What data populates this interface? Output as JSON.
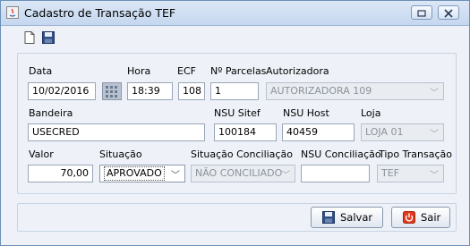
{
  "window": {
    "title": "Cadastro de Transação TEF"
  },
  "toolbar": {
    "new_icon": "new-document-icon",
    "save_icon": "floppy-disk-icon"
  },
  "labels": {
    "data": "Data",
    "hora": "Hora",
    "ecf": "ECF",
    "parcelas": "Nº Parcelas",
    "autorizadora": "Autorizadora",
    "bandeira": "Bandeira",
    "nsu_sitef": "NSU Sitef",
    "nsu_host": "NSU Host",
    "loja": "Loja",
    "valor": "Valor",
    "situacao": "Situação",
    "situacao_conciliacao": "Situação Conciliação",
    "nsu_conciliacao": "NSU Conciliação",
    "tipo_transacao": "Tipo Transação"
  },
  "fields": {
    "data": "10/02/2016",
    "hora": "18:39",
    "ecf": "108",
    "parcelas": "1",
    "autorizadora": "AUTORIZADORA 109",
    "bandeira": "USECRED",
    "nsu_sitef": "100184",
    "nsu_host": "40459",
    "loja": "LOJA 01",
    "valor": "70,00",
    "situacao": "APROVADO",
    "situacao_conciliacao": "NÃO CONCILIADO",
    "nsu_conciliacao": "",
    "tipo_transacao": "TEF"
  },
  "buttons": {
    "salvar": "Salvar",
    "sair": "Sair"
  },
  "colors": {
    "title_bar": "#c5d7ef",
    "panel_bg": "#eef2f8",
    "sair_icon": "#e03a1e"
  }
}
